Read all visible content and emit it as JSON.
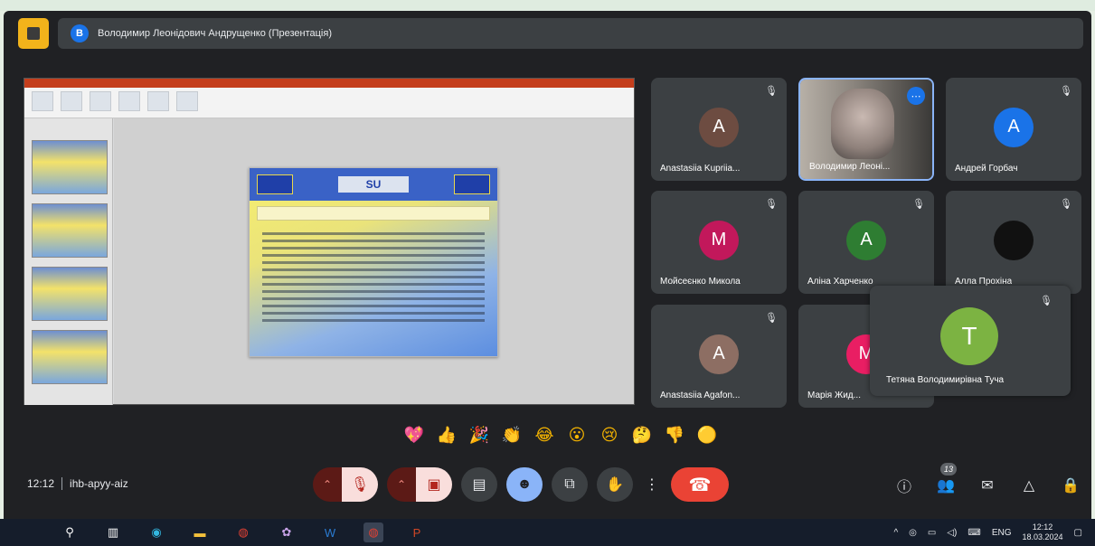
{
  "header": {
    "presenter_initial": "В",
    "presenter_title": "Володимир Леонідович Андрущенко (Презентація)"
  },
  "slide": {
    "logo_text": "SU"
  },
  "participants": [
    {
      "initial": "А",
      "name": "Anastasiia Kupriia...",
      "color": "#6d4c41",
      "muted": true
    },
    {
      "initial": "",
      "name": "Володимир Леоні...",
      "color": "",
      "muted": false,
      "video": true
    },
    {
      "initial": "А",
      "name": "Андрей Горбач",
      "color": "#1a73e8",
      "muted": true
    },
    {
      "initial": "M",
      "name": "Мойсеєнко Микола",
      "color": "#c2185b",
      "muted": true
    },
    {
      "initial": "А",
      "name": "Аліна Харченко",
      "color": "#2e7d32",
      "muted": true
    },
    {
      "initial": "",
      "name": "Алла Прохіна",
      "color": "#111111",
      "muted": true
    },
    {
      "initial": "А",
      "name": "Anastasiia Agafon...",
      "color": "#8d6e63",
      "muted": true
    },
    {
      "initial": "М",
      "name": "Марія Жид...",
      "color": "#e91e63",
      "muted": false
    }
  ],
  "spotlight": {
    "initial": "T",
    "name": "Тетяна Володимирівна Туча",
    "color": "#7cb342"
  },
  "reactions": [
    "💖",
    "👍",
    "🎉",
    "👏",
    "😂",
    "😮",
    "😢",
    "🤔",
    "👎",
    "🟡"
  ],
  "meeting": {
    "time": "12:12",
    "code": "ihb-apyy-aiz"
  },
  "controls": {
    "more_label": "⋮",
    "participants_count": "13"
  },
  "taskbar": {
    "lang": "ENG",
    "time": "12:12",
    "date": "18.03.2024"
  },
  "colors": {
    "background": "#202124",
    "tile": "#3c4043",
    "accent": "#8ab4f8",
    "end_call": "#ea4335",
    "taskbar": "#151d2b"
  }
}
